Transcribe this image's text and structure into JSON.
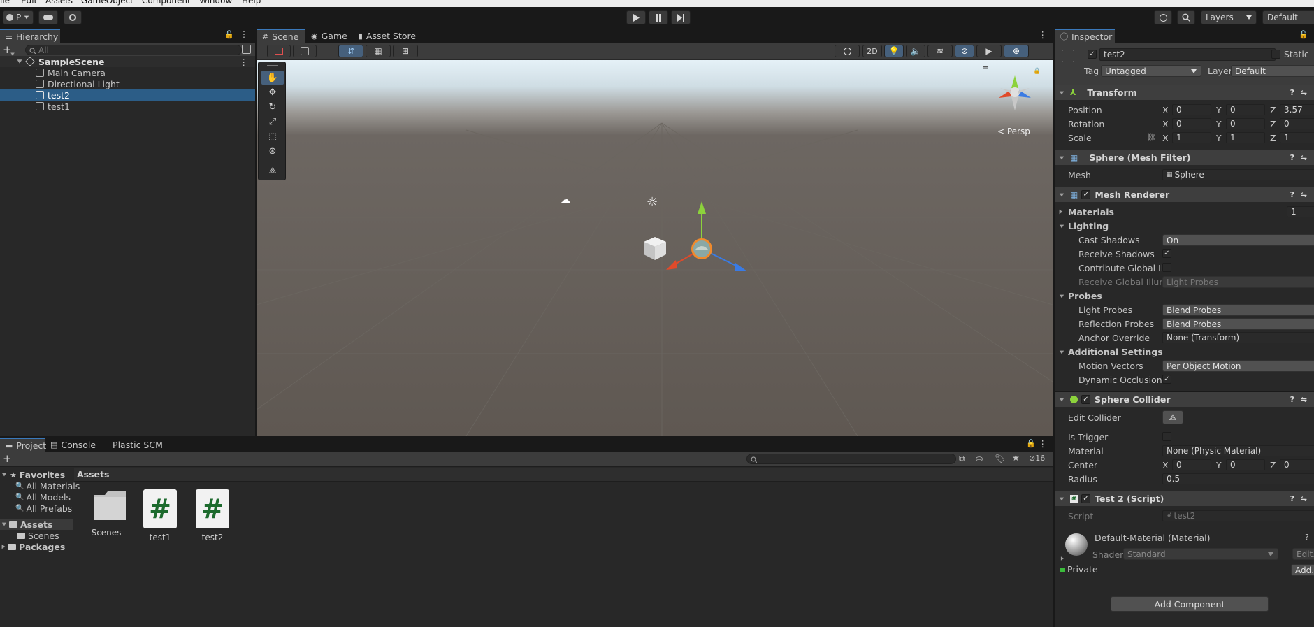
{
  "menubar": {
    "items": [
      "ile",
      "Edit",
      "Assets",
      "GameObject",
      "Component",
      "Window",
      "Help"
    ]
  },
  "toolbar": {
    "account_label": "P",
    "layers_label": "Layers",
    "layout_label": "Default"
  },
  "hierarchy": {
    "tab_label": "Hierarchy",
    "search_placeholder": "All",
    "scene_name": "SampleScene",
    "items": [
      {
        "label": "Main Camera"
      },
      {
        "label": "Directional Light"
      },
      {
        "label": "test2"
      },
      {
        "label": "test1"
      }
    ]
  },
  "scene_view": {
    "tabs": [
      {
        "label": "Scene"
      },
      {
        "label": "Game"
      },
      {
        "label": "Asset Store"
      }
    ],
    "mode_2d_label": "2D",
    "persp_label": "< Persp",
    "gizmo_count": ""
  },
  "project": {
    "tabs": [
      {
        "label": "Project"
      },
      {
        "label": "Console"
      },
      {
        "label": "Plastic SCM"
      }
    ],
    "hidden_count": "16",
    "favorites_label": "Favorites",
    "favorites": [
      {
        "label": "All Materials"
      },
      {
        "label": "All Models"
      },
      {
        "label": "All Prefabs"
      }
    ],
    "assets_label": "Assets",
    "assets_children": [
      {
        "label": "Scenes"
      }
    ],
    "packages_label": "Packages",
    "breadcrumb": "Assets",
    "asset_items": [
      {
        "label": "Scenes",
        "icon": "folder-icon"
      },
      {
        "label": "test1",
        "icon": "script-hash-icon"
      },
      {
        "label": "test2",
        "icon": "script-hash-icon"
      }
    ]
  },
  "inspector": {
    "tab_label": "Inspector",
    "object_name": "test2",
    "static_label": "Static",
    "tag_label": "Tag",
    "tag_value": "Untagged",
    "layer_label": "Layer",
    "layer_value": "Default",
    "transform": {
      "title": "Transform",
      "position_label": "Position",
      "position": {
        "x": "0",
        "y": "0",
        "z": "3.57"
      },
      "rotation_label": "Rotation",
      "rotation": {
        "x": "0",
        "y": "0",
        "z": "0"
      },
      "scale_label": "Scale",
      "scale": {
        "x": "1",
        "y": "1",
        "z": "1"
      }
    },
    "mesh_filter": {
      "title": "Sphere (Mesh Filter)",
      "mesh_label": "Mesh",
      "mesh_value": "Sphere"
    },
    "mesh_renderer": {
      "title": "Mesh Renderer",
      "materials_label": "Materials",
      "materials_count": "1",
      "lighting_label": "Lighting",
      "cast_shadows_label": "Cast Shadows",
      "cast_shadows_value": "On",
      "receive_shadows_label": "Receive Shadows",
      "contribute_gi_label": "Contribute Global Illu",
      "receive_gi_label": "Receive Global Illumi",
      "receive_gi_value": "Light Probes",
      "probes_label": "Probes",
      "light_probes_label": "Light Probes",
      "light_probes_value": "Blend Probes",
      "reflection_probes_label": "Reflection Probes",
      "reflection_probes_value": "Blend Probes",
      "anchor_override_label": "Anchor Override",
      "anchor_override_value": "None (Transform)",
      "additional_label": "Additional Settings",
      "motion_vectors_label": "Motion Vectors",
      "motion_vectors_value": "Per Object Motion",
      "dynamic_occlusion_label": "Dynamic Occlusion"
    },
    "sphere_collider": {
      "title": "Sphere Collider",
      "edit_collider_label": "Edit Collider",
      "is_trigger_label": "Is Trigger",
      "material_label": "Material",
      "material_value": "None (Physic Material)",
      "center_label": "Center",
      "center": {
        "x": "0",
        "y": "0",
        "z": "0"
      },
      "radius_label": "Radius",
      "radius_value": "0.5"
    },
    "script_comp": {
      "title": "Test 2 (Script)",
      "script_label": "Script",
      "script_value": "test2"
    },
    "material": {
      "title": "Default-Material (Material)",
      "shader_label": "Shader",
      "shader_value": "Standard",
      "edit_label": "Edit...",
      "private_label": "Private",
      "add_label": "Add..."
    },
    "add_component_label": "Add Component",
    "axis": {
      "x": "X",
      "y": "Y",
      "z": "Z"
    }
  }
}
